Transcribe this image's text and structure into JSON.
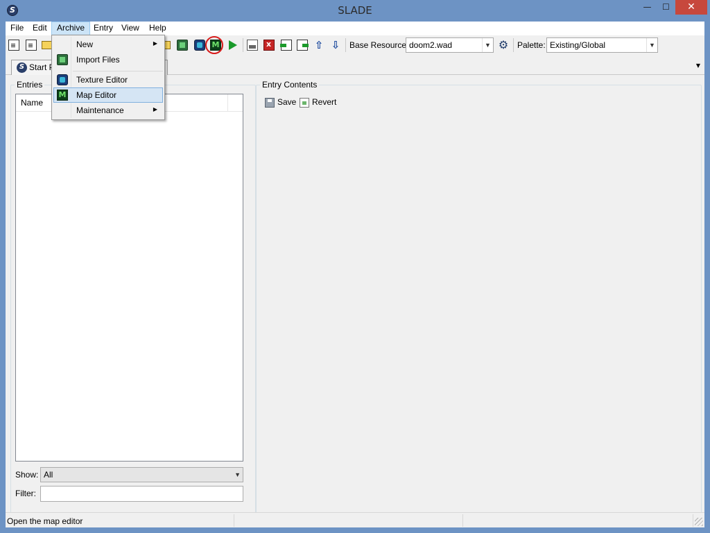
{
  "window": {
    "title": "SLADE",
    "app_icon_glyph": "S"
  },
  "caption_buttons": {
    "minimize": "—",
    "maximize": "☐",
    "close": "✕"
  },
  "menubar": {
    "items": [
      {
        "label": "File"
      },
      {
        "label": "Edit"
      },
      {
        "label": "Archive"
      },
      {
        "label": "Entry"
      },
      {
        "label": "View"
      },
      {
        "label": "Help"
      }
    ],
    "open_item": "Archive"
  },
  "toolbar": {
    "base_resource_label": "Base Resource:",
    "base_resource_value": "doom2.wad",
    "palette_label": "Palette:",
    "palette_value": "Existing/Global",
    "highlighted_button": "map-editor",
    "colors": {
      "highlight_ring": "#d81b1b"
    }
  },
  "tabs": {
    "start_page_label": "Start Page"
  },
  "entries_panel": {
    "title": "Entries",
    "column_name": "Name",
    "show_label": "Show:",
    "show_value": "All",
    "filter_label": "Filter:",
    "filter_value": ""
  },
  "contents_panel": {
    "title": "Entry Contents",
    "save_label": "Save",
    "revert_label": "Revert"
  },
  "archive_menu": {
    "items": [
      {
        "label": "New",
        "icon": "none",
        "submenu": true
      },
      {
        "label": "Import Files",
        "icon": "import-icon",
        "submenu": false
      },
      {
        "label": "Texture Editor",
        "icon": "texture-editor-icon",
        "submenu": false
      },
      {
        "label": "Map Editor",
        "icon": "map-editor-icon",
        "submenu": false,
        "hovered": true
      },
      {
        "label": "Maintenance",
        "icon": "none",
        "submenu": true
      }
    ]
  },
  "statusbar": {
    "text": "Open the map editor"
  }
}
